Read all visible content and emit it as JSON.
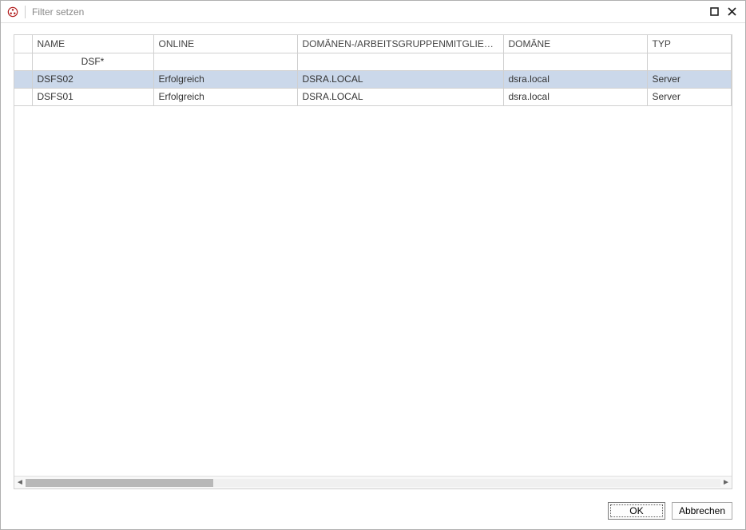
{
  "window": {
    "title": "Filter setzen"
  },
  "table": {
    "columns": [
      "NAME",
      "ONLINE",
      "DOMÄNEN-/ARBEITSGRUPPENMITGLIEDSCH...",
      "DOMÄNE",
      "TYP"
    ],
    "filter": {
      "name": "DSF*",
      "online": "",
      "membership": "",
      "domain": "",
      "type": ""
    },
    "rows": [
      {
        "name": "DSFS02",
        "online": "Erfolgreich",
        "membership": "DSRA.LOCAL",
        "domain": "dsra.local",
        "type": "Server",
        "selected": true
      },
      {
        "name": "DSFS01",
        "online": "Erfolgreich",
        "membership": "DSRA.LOCAL",
        "domain": "dsra.local",
        "type": "Server",
        "selected": false
      }
    ]
  },
  "buttons": {
    "ok": "OK",
    "cancel": "Abbrechen"
  }
}
